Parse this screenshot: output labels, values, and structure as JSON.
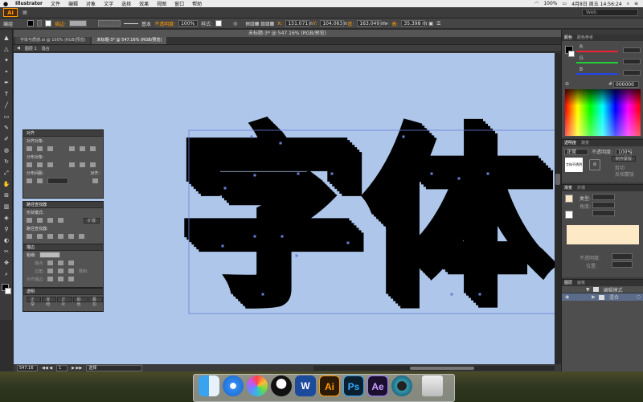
{
  "menubar": {
    "apple_icon": "apple-icon",
    "app_name": "Illustrator",
    "items": [
      "文件",
      "编辑",
      "对象",
      "文字",
      "选择",
      "效果",
      "视图",
      "窗口",
      "帮助"
    ],
    "battery": "100%",
    "clock": "4月8日 周五 14:56:24"
  },
  "appbar": {
    "logo": "Ai",
    "search_placeholder": "Web"
  },
  "controlbar": {
    "label_path": "编组",
    "stroke_label": "描边:",
    "stroke_style": "基本",
    "opacity_label": "不透明度:",
    "opacity_value": "100%",
    "style_label": "样式:",
    "x_label": "X:",
    "x_value": "151.071 n",
    "y_label": "Y:",
    "y_value": "104.063 n",
    "w_label": "宽:",
    "w_value": "163.049 m",
    "h_label": "高:",
    "h_value": "35.398 m"
  },
  "document": {
    "window_title": "未标题-3* @ 547.16% (RGB/预览)",
    "tabs": [
      {
        "label": "字体与质感.ai @ 100% (RGB/预览)",
        "active": false
      },
      {
        "label": "未标题-3* @ 547.16% (RGB/预览)",
        "active": true
      }
    ],
    "breadcrumb": [
      "图层 1",
      "混合"
    ],
    "canvas_text": "字体",
    "canvas_bg": "#adc6ea",
    "status": {
      "zoom": "547.16",
      "page": "1",
      "tool": "选择"
    }
  },
  "align_panel": {
    "title": "对齐",
    "align_objects": "对齐对象:",
    "distribute_objects": "分布对象:",
    "distribute_spacing": "分布间距:",
    "align_to": "对齐:"
  },
  "pathfinder_panel": {
    "title": "路径查找器",
    "shape_modes": "形状模式:",
    "expand": "扩展",
    "pathfinders": "路径查找器:"
  },
  "stroke_panel": {
    "title": "描边",
    "weight": "粗细:",
    "cap": "端点:",
    "corner": "边角:",
    "align_stroke": "对齐描边:",
    "limit": "限制:"
  },
  "transparency_mini": {
    "title": "透明",
    "buttons": [
      "正常",
      "变暗",
      "正片",
      "颜色",
      "叠加"
    ]
  },
  "color_panel": {
    "tabs": [
      "颜色",
      "颜色参考"
    ],
    "channels": [
      {
        "name": "R",
        "color": "#e23"
      },
      {
        "name": "G",
        "color": "#2c3"
      },
      {
        "name": "B",
        "color": "#24e"
      }
    ],
    "hex_value": "000000"
  },
  "transparency_panel": {
    "tabs": [
      "透明度",
      "渐变"
    ],
    "mode": "正常",
    "opacity_label": "不透明度:",
    "opacity_value": "100%",
    "thumb_text": "字体不透明",
    "make_mask": "制作蒙版",
    "clip": "剪切",
    "invert_mask": "反相蒙版"
  },
  "gradient_panel": {
    "tabs": [
      "渐变",
      "外观"
    ],
    "type_label": "类型:",
    "angle_label": "角度:",
    "opacity_label": "不透明度:",
    "location_label": "位置:",
    "preview_color": "#fde9c5"
  },
  "layers_panel": {
    "tabs": [
      "图层",
      "画板"
    ],
    "rows": [
      "编辑模式",
      "混合"
    ]
  },
  "dock_apps": [
    {
      "name": "finder",
      "label": ""
    },
    {
      "name": "safari",
      "label": ""
    },
    {
      "name": "photos",
      "label": ""
    },
    {
      "name": "qq",
      "label": ""
    },
    {
      "name": "word",
      "label": "W"
    },
    {
      "name": "illustrator",
      "label": "Ai"
    },
    {
      "name": "photoshop",
      "label": "Ps"
    },
    {
      "name": "after-effects",
      "label": "Ae"
    },
    {
      "name": "quicktime",
      "label": ""
    },
    {
      "name": "trash",
      "label": ""
    }
  ]
}
